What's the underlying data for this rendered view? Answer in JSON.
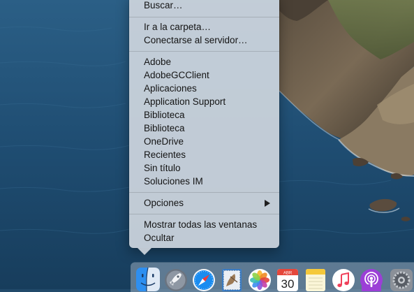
{
  "menu": {
    "top_items": [
      "Buscar…"
    ],
    "go_items": [
      "Ir a la carpeta…",
      "Conectarse al servidor…"
    ],
    "folders": [
      "Adobe",
      "AdobeGCClient",
      "Aplicaciones",
      "Application Support",
      "Biblioteca",
      "Biblioteca",
      "OneDrive",
      "Recientes",
      "Sin título",
      "Soluciones IM"
    ],
    "options_label": "Opciones",
    "bottom_items": [
      "Mostrar todas las ventanas",
      "Ocultar"
    ]
  },
  "dock": {
    "apps": [
      {
        "name": "finder-icon"
      },
      {
        "name": "launchpad-icon"
      },
      {
        "name": "safari-icon"
      },
      {
        "name": "mail-icon"
      },
      {
        "name": "photos-icon"
      },
      {
        "name": "calendar-icon",
        "month": "ABR",
        "day": "30"
      },
      {
        "name": "notes-icon"
      },
      {
        "name": "music-icon"
      },
      {
        "name": "podcasts-icon"
      },
      {
        "name": "system-preferences-icon"
      }
    ],
    "colors": {
      "calendar_month": "#e5473b",
      "podcasts": "#9b3fd6",
      "music": "#f0405a",
      "safari": "#1a8cf0"
    }
  }
}
